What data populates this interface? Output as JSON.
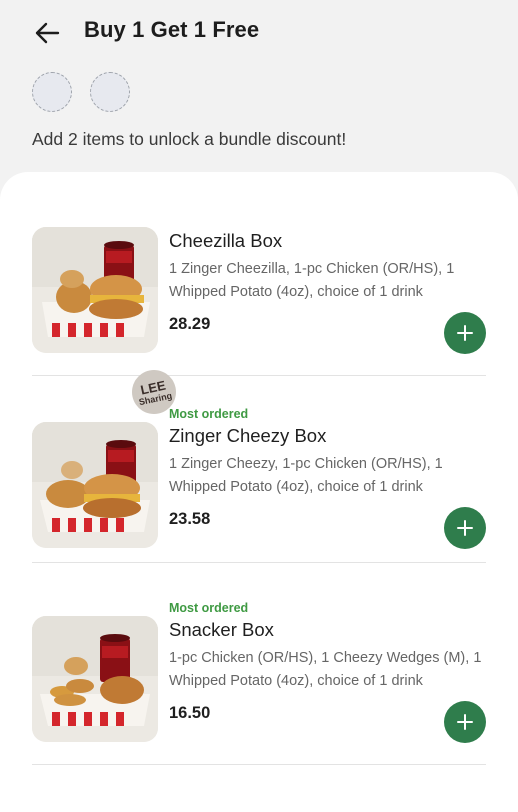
{
  "header": {
    "title": "Buy 1 Get 1 Free",
    "back_icon": "arrow-left-icon"
  },
  "bundle": {
    "slots": 2,
    "message": "Add 2 items to unlock a bundle discount!"
  },
  "items": [
    {
      "badge": "",
      "name": "Cheezilla Box",
      "description": "1 Zinger Cheezilla, 1-pc Chicken (OR/HS), 1 Whipped Potato (4oz), choice of 1 drink",
      "price": "28.29"
    },
    {
      "badge": "Most ordered",
      "name": "Zinger Cheezy Box",
      "description": "1 Zinger Cheezy, 1-pc Chicken (OR/HS), 1 Whipped Potato (4oz), choice of 1 drink",
      "price": "23.58",
      "sticker": {
        "line1": "LEE",
        "line2": "Sharing"
      }
    },
    {
      "badge": "Most ordered",
      "name": "Snacker Box",
      "description": "1-pc Chicken (OR/HS), 1 Cheezy Wedges (M), 1 Whipped Potato (4oz), choice of 1 drink",
      "price": "16.50"
    }
  ],
  "colors": {
    "accent_green": "#2f7d4c",
    "badge_green": "#3f9a43",
    "background": "#f2f2f2"
  }
}
